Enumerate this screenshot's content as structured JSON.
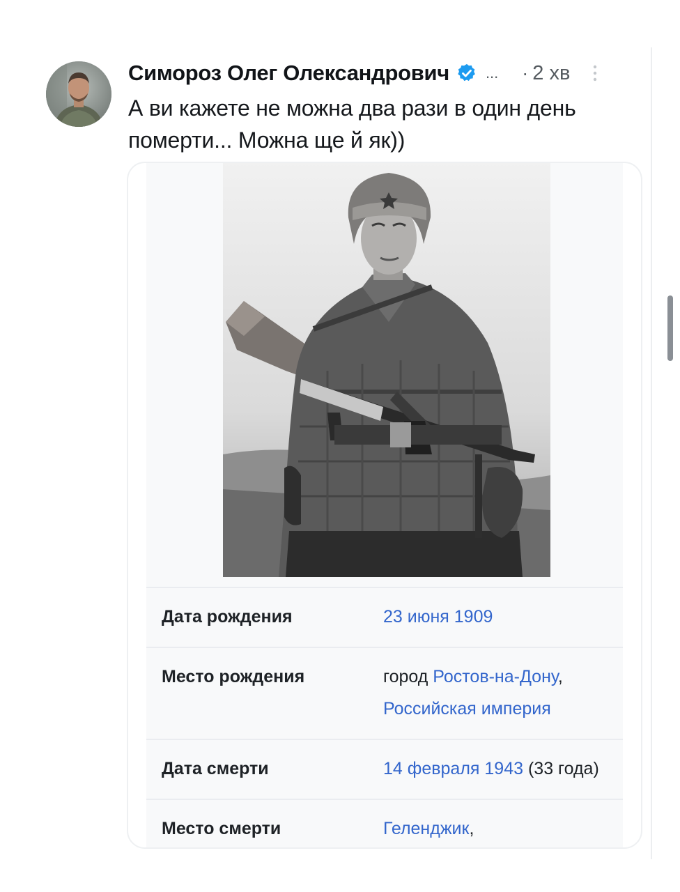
{
  "post": {
    "author_name": "Симороз Олег Олександрович",
    "ellipsis": "...",
    "dot_separator": "·",
    "time_ago": "2 хв",
    "text_line1": "А ви кажете не можна два рази в один день",
    "text_line2": "померти... Можна ще й як))"
  },
  "icons": {
    "verified": "verified-badge-icon",
    "more": "more-vertical-icon"
  },
  "colors": {
    "verified": "#1d9bf0",
    "link": "#3366cc",
    "infobox_bg": "#f8f9fa"
  },
  "infobox": {
    "rows": [
      {
        "label": "Дата рождения",
        "value_link": "23 июня 1909"
      },
      {
        "label": "Место рождения",
        "value_prefix": "город ",
        "value_link1": "Ростов-на-Дону",
        "value_sep": ",",
        "value_link2": "Российская империя"
      },
      {
        "label": "Дата смерти",
        "value_link": "14 февраля 1943",
        "value_rest": " (33 года)"
      },
      {
        "label": "Место смерти",
        "value_link": "Геленджик",
        "value_sep": ","
      }
    ]
  }
}
